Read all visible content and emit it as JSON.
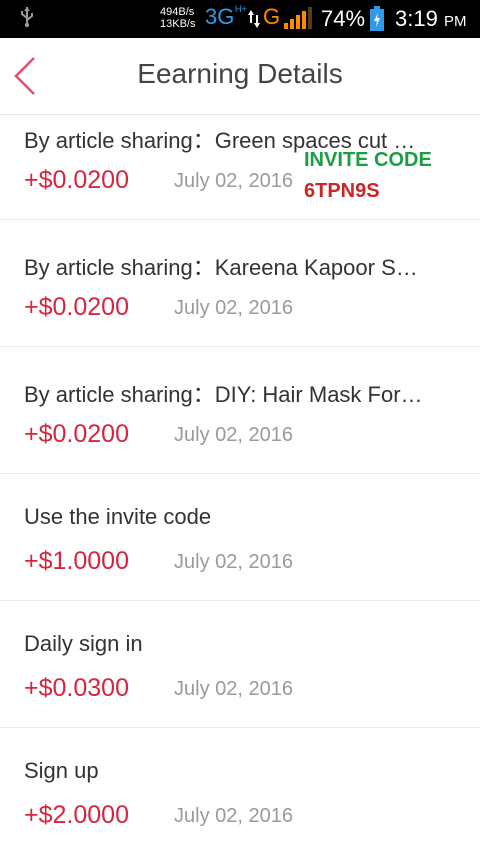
{
  "status_bar": {
    "net_up": "494B/s",
    "net_down": "13KB/s",
    "network_3g": "3G",
    "network_hplus": "H+",
    "network_g": "G",
    "battery_percent": "74%",
    "time": "3:19",
    "ampm": "PM",
    "icons": [
      "usb-icon",
      "data-arrows-icon",
      "signal-icon",
      "battery-icon"
    ]
  },
  "header": {
    "title": "Eearning Details",
    "back_icon": "back-chevron-icon"
  },
  "items": [
    {
      "desc": "By article sharing：Green spaces cut …",
      "amount": "+$0.0200",
      "date": "July 02, 2016"
    },
    {
      "desc": "By article sharing：Kareena Kapoor S…",
      "amount": "+$0.0200",
      "date": "July 02, 2016"
    },
    {
      "desc": "By article sharing：DIY: Hair Mask For…",
      "amount": "+$0.0200",
      "date": "July 02, 2016"
    },
    {
      "desc": "Use the invite code",
      "amount": "+$1.0000",
      "date": "July 02, 2016"
    },
    {
      "desc": "Daily sign in",
      "amount": "+$0.0300",
      "date": "July 02, 2016"
    },
    {
      "desc": "Sign up",
      "amount": "+$2.0000",
      "date": "July 02, 2016"
    }
  ],
  "overlay": {
    "line1": "INVITE CODE",
    "line2": "6TPN9S"
  },
  "colors": {
    "amount": "#d7243f",
    "back_chevron": "#e0506a",
    "invite_green": "#1a9e44",
    "invite_red": "#c8262b"
  }
}
